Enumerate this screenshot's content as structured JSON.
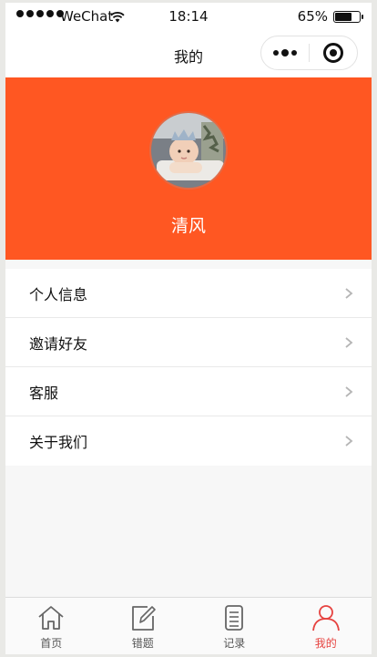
{
  "status_bar": {
    "carrier": "WeChat",
    "time": "18:14",
    "battery_percent": "65%",
    "battery_level": 0.65
  },
  "nav": {
    "title": "我的"
  },
  "profile": {
    "username": "清风"
  },
  "menu": [
    {
      "label": "个人信息"
    },
    {
      "label": "邀请好友"
    },
    {
      "label": "客服"
    },
    {
      "label": "关于我们"
    }
  ],
  "tabbar": {
    "tabs": [
      {
        "label": "首页",
        "icon": "home-icon",
        "active": false
      },
      {
        "label": "错题",
        "icon": "edit-icon",
        "active": false
      },
      {
        "label": "记录",
        "icon": "document-icon",
        "active": false
      },
      {
        "label": "我的",
        "icon": "user-icon",
        "active": true
      }
    ]
  },
  "colors": {
    "accent": "#ff5722",
    "tab_active": "#e64340",
    "tab_inactive": "#555555"
  }
}
